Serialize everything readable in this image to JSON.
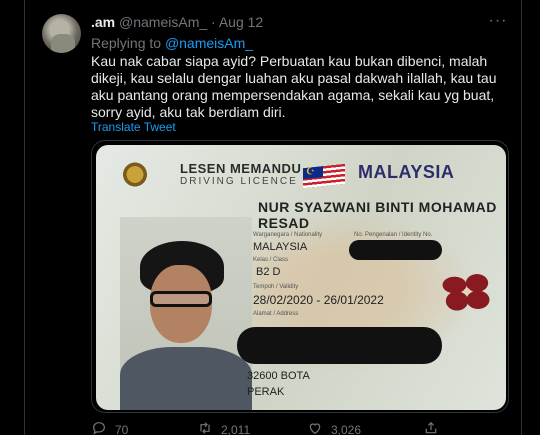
{
  "tweet": {
    "display_name": ".am",
    "handle": "@nameisAm_",
    "separator": "·",
    "date": "Aug 12",
    "more_label": "···",
    "replying_prefix": "Replying to",
    "replying_handle": "@nameisAm_",
    "text": "Kau nak cabar siapa ayid? Perbuatan kau bukan dibenci, malah dikeji, kau selalu dengar luahan aku pasal dakwah ilallah, kau tau aku pantang orang mempersendakan agama, sekali kau yg buat, sorry ayid, aku tak berdiam diri.",
    "translate_label": "Translate Tweet"
  },
  "license_card": {
    "title": "LESEN MEMANDU",
    "subtitle": "DRIVING LICENCE",
    "country": "MALAYSIA",
    "name_line1": "NUR SYAZWANI BINTI MOHAMAD",
    "name_line2": "RESAD",
    "nationality_label": "Warganegara / Nationality",
    "id_label": "No. Pengenalan / Identity No.",
    "nationality_value": "MALAYSIA",
    "class_label": "Kelas / Class",
    "class_value": "B2 D",
    "validity_label": "Tempoh / Validity",
    "validity_value": "28/02/2020 - 26/01/2022",
    "address_label": "Alamat / Address",
    "address_line1": "32600 BOTA",
    "address_line2": "PERAK"
  },
  "actions": {
    "replies": "70",
    "retweets": "2,011",
    "likes": "3,026"
  },
  "icons": {
    "more": "more-horizontal-icon",
    "reply": "reply-icon",
    "retweet": "retweet-icon",
    "like": "heart-icon",
    "share": "share-icon"
  },
  "colors": {
    "background": "#000000",
    "text": "#e7e9ea",
    "muted": "#71767b",
    "accent": "#1d9bf0"
  }
}
